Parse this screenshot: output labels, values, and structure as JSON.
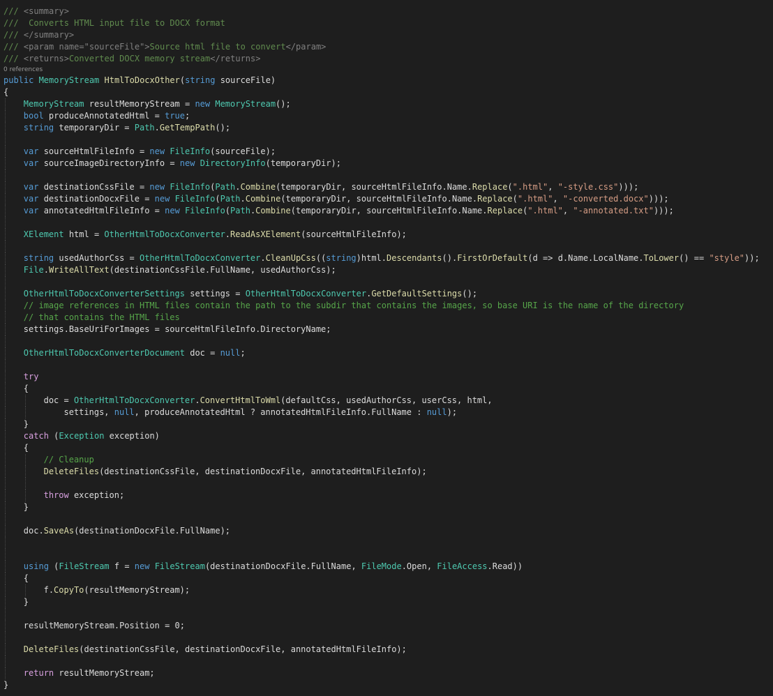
{
  "editor": {
    "colors": {
      "background": "#1e1e1e",
      "text": "#dcdcdc",
      "comment": "#57a64a",
      "doc_comment": "#608b4e",
      "doc_tag": "#808080",
      "keyword": "#569cd6",
      "control_keyword": "#d8a0df",
      "type": "#4ec9b0",
      "method": "#dcdcaa",
      "string": "#d69d85",
      "code_lens": "#999999"
    },
    "lines": [
      {
        "indent": 0,
        "tokens": [
          [
            "doc",
            "/// "
          ],
          [
            "tag",
            "<summary>"
          ]
        ]
      },
      {
        "indent": 0,
        "tokens": [
          [
            "doc",
            "///  Converts HTML input file to DOCX format"
          ]
        ]
      },
      {
        "indent": 0,
        "tokens": [
          [
            "doc",
            "/// "
          ],
          [
            "tag",
            "</summary>"
          ]
        ]
      },
      {
        "indent": 0,
        "tokens": [
          [
            "doc",
            "/// "
          ],
          [
            "tag",
            "<param name=\"sourceFile\">"
          ],
          [
            "doc",
            "Source html file to convert"
          ],
          [
            "tag",
            "</param>"
          ]
        ]
      },
      {
        "indent": 0,
        "tokens": [
          [
            "doc",
            "/// "
          ],
          [
            "tag",
            "<returns>"
          ],
          [
            "doc",
            "Converted DOCX memory stream"
          ],
          [
            "tag",
            "</returns>"
          ]
        ]
      },
      {
        "indent": 0,
        "lens": true,
        "tokens": [
          [
            "lens",
            "0 references"
          ]
        ]
      },
      {
        "indent": 0,
        "tokens": [
          [
            "kw",
            "public "
          ],
          [
            "type",
            "MemoryStream "
          ],
          [
            "meth",
            "HtmlToDocxOther"
          ],
          [
            "plain",
            "("
          ],
          [
            "kw",
            "string "
          ],
          [
            "plain",
            "sourceFile)"
          ]
        ]
      },
      {
        "indent": 0,
        "tokens": [
          [
            "plain",
            "{"
          ]
        ]
      },
      {
        "indent": 1,
        "tokens": [
          [
            "type",
            "MemoryStream "
          ],
          [
            "plain",
            "resultMemoryStream = "
          ],
          [
            "kw",
            "new "
          ],
          [
            "type",
            "MemoryStream"
          ],
          [
            "plain",
            "();"
          ]
        ]
      },
      {
        "indent": 1,
        "tokens": [
          [
            "kw",
            "bool "
          ],
          [
            "plain",
            "produceAnnotatedHtml = "
          ],
          [
            "kw",
            "true"
          ],
          [
            "plain",
            ";"
          ]
        ]
      },
      {
        "indent": 1,
        "tokens": [
          [
            "kw",
            "string "
          ],
          [
            "plain",
            "temporaryDir = "
          ],
          [
            "type",
            "Path"
          ],
          [
            "plain",
            "."
          ],
          [
            "meth",
            "GetTempPath"
          ],
          [
            "plain",
            "();"
          ]
        ]
      },
      {
        "indent": 1,
        "tokens": []
      },
      {
        "indent": 1,
        "tokens": [
          [
            "kw",
            "var "
          ],
          [
            "plain",
            "sourceHtmlFileInfo = "
          ],
          [
            "kw",
            "new "
          ],
          [
            "type",
            "FileInfo"
          ],
          [
            "plain",
            "(sourceFile);"
          ]
        ]
      },
      {
        "indent": 1,
        "tokens": [
          [
            "kw",
            "var "
          ],
          [
            "plain",
            "sourceImageDirectoryInfo = "
          ],
          [
            "kw",
            "new "
          ],
          [
            "type",
            "DirectoryInfo"
          ],
          [
            "plain",
            "(temporaryDir);"
          ]
        ]
      },
      {
        "indent": 1,
        "tokens": []
      },
      {
        "indent": 1,
        "tokens": [
          [
            "kw",
            "var "
          ],
          [
            "plain",
            "destinationCssFile = "
          ],
          [
            "kw",
            "new "
          ],
          [
            "type",
            "FileInfo"
          ],
          [
            "plain",
            "("
          ],
          [
            "type",
            "Path"
          ],
          [
            "plain",
            "."
          ],
          [
            "meth",
            "Combine"
          ],
          [
            "plain",
            "(temporaryDir, sourceHtmlFileInfo.Name."
          ],
          [
            "meth",
            "Replace"
          ],
          [
            "plain",
            "("
          ],
          [
            "str",
            "\".html\""
          ],
          [
            "plain",
            ", "
          ],
          [
            "str",
            "\"-style.css\""
          ],
          [
            "plain",
            ")));"
          ]
        ]
      },
      {
        "indent": 1,
        "tokens": [
          [
            "kw",
            "var "
          ],
          [
            "plain",
            "destinationDocxFile = "
          ],
          [
            "kw",
            "new "
          ],
          [
            "type",
            "FileInfo"
          ],
          [
            "plain",
            "("
          ],
          [
            "type",
            "Path"
          ],
          [
            "plain",
            "."
          ],
          [
            "meth",
            "Combine"
          ],
          [
            "plain",
            "(temporaryDir, sourceHtmlFileInfo.Name."
          ],
          [
            "meth",
            "Replace"
          ],
          [
            "plain",
            "("
          ],
          [
            "str",
            "\".html\""
          ],
          [
            "plain",
            ", "
          ],
          [
            "str",
            "\"-converted.docx\""
          ],
          [
            "plain",
            ")));"
          ]
        ]
      },
      {
        "indent": 1,
        "tokens": [
          [
            "kw",
            "var "
          ],
          [
            "plain",
            "annotatedHtmlFileInfo = "
          ],
          [
            "kw",
            "new "
          ],
          [
            "type",
            "FileInfo"
          ],
          [
            "plain",
            "("
          ],
          [
            "type",
            "Path"
          ],
          [
            "plain",
            "."
          ],
          [
            "meth",
            "Combine"
          ],
          [
            "plain",
            "(temporaryDir, sourceHtmlFileInfo.Name."
          ],
          [
            "meth",
            "Replace"
          ],
          [
            "plain",
            "("
          ],
          [
            "str",
            "\".html\""
          ],
          [
            "plain",
            ", "
          ],
          [
            "str",
            "\"-annotated.txt\""
          ],
          [
            "plain",
            ")));"
          ]
        ]
      },
      {
        "indent": 1,
        "tokens": []
      },
      {
        "indent": 1,
        "tokens": [
          [
            "type",
            "XElement "
          ],
          [
            "plain",
            "html = "
          ],
          [
            "type",
            "OtherHtmlToDocxConverter"
          ],
          [
            "plain",
            "."
          ],
          [
            "meth",
            "ReadAsXElement"
          ],
          [
            "plain",
            "(sourceHtmlFileInfo);"
          ]
        ]
      },
      {
        "indent": 1,
        "tokens": []
      },
      {
        "indent": 1,
        "tokens": [
          [
            "kw",
            "string "
          ],
          [
            "plain",
            "usedAuthorCss = "
          ],
          [
            "type",
            "OtherHtmlToDocxConverter"
          ],
          [
            "plain",
            "."
          ],
          [
            "meth",
            "CleanUpCss"
          ],
          [
            "plain",
            "(("
          ],
          [
            "kw",
            "string"
          ],
          [
            "plain",
            ")html."
          ],
          [
            "meth",
            "Descendants"
          ],
          [
            "plain",
            "()."
          ],
          [
            "meth",
            "FirstOrDefault"
          ],
          [
            "plain",
            "(d => d.Name.LocalName."
          ],
          [
            "meth",
            "ToLower"
          ],
          [
            "plain",
            "() == "
          ],
          [
            "str",
            "\"style\""
          ],
          [
            "plain",
            "));"
          ]
        ]
      },
      {
        "indent": 1,
        "tokens": [
          [
            "type",
            "File"
          ],
          [
            "plain",
            "."
          ],
          [
            "meth",
            "WriteAllText"
          ],
          [
            "plain",
            "(destinationCssFile.FullName, usedAuthorCss);"
          ]
        ]
      },
      {
        "indent": 1,
        "tokens": []
      },
      {
        "indent": 1,
        "tokens": [
          [
            "type",
            "OtherHtmlToDocxConverterSettings "
          ],
          [
            "plain",
            "settings = "
          ],
          [
            "type",
            "OtherHtmlToDocxConverter"
          ],
          [
            "plain",
            "."
          ],
          [
            "meth",
            "GetDefaultSettings"
          ],
          [
            "plain",
            "();"
          ]
        ]
      },
      {
        "indent": 1,
        "tokens": [
          [
            "com",
            "// image references in HTML files contain the path to the subdir that contains the images, so base URI is the name of the directory"
          ]
        ]
      },
      {
        "indent": 1,
        "tokens": [
          [
            "com",
            "// that contains the HTML files"
          ]
        ]
      },
      {
        "indent": 1,
        "tokens": [
          [
            "plain",
            "settings.BaseUriForImages = sourceHtmlFileInfo.DirectoryName;"
          ]
        ]
      },
      {
        "indent": 1,
        "tokens": []
      },
      {
        "indent": 1,
        "tokens": [
          [
            "type",
            "OtherHtmlToDocxConverterDocument "
          ],
          [
            "plain",
            "doc = "
          ],
          [
            "kw",
            "null"
          ],
          [
            "plain",
            ";"
          ]
        ]
      },
      {
        "indent": 1,
        "tokens": []
      },
      {
        "indent": 1,
        "tokens": [
          [
            "ctl",
            "try"
          ]
        ]
      },
      {
        "indent": 1,
        "tokens": [
          [
            "plain",
            "{"
          ]
        ]
      },
      {
        "indent": 2,
        "tokens": [
          [
            "plain",
            "doc = "
          ],
          [
            "type",
            "OtherHtmlToDocxConverter"
          ],
          [
            "plain",
            "."
          ],
          [
            "meth",
            "ConvertHtmlToWml"
          ],
          [
            "plain",
            "(defaultCss, usedAuthorCss, userCss, html,"
          ]
        ]
      },
      {
        "indent": 2,
        "tokens": [
          [
            "plain",
            "    settings, "
          ],
          [
            "kw",
            "null"
          ],
          [
            "plain",
            ", produceAnnotatedHtml ? annotatedHtmlFileInfo.FullName : "
          ],
          [
            "kw",
            "null"
          ],
          [
            "plain",
            ");"
          ]
        ]
      },
      {
        "indent": 1,
        "tokens": [
          [
            "plain",
            "}"
          ]
        ]
      },
      {
        "indent": 1,
        "tokens": [
          [
            "ctl",
            "catch "
          ],
          [
            "plain",
            "("
          ],
          [
            "type",
            "Exception "
          ],
          [
            "plain",
            "exception)"
          ]
        ]
      },
      {
        "indent": 1,
        "tokens": [
          [
            "plain",
            "{"
          ]
        ]
      },
      {
        "indent": 2,
        "tokens": [
          [
            "com",
            "// Cleanup"
          ]
        ]
      },
      {
        "indent": 2,
        "tokens": [
          [
            "meth",
            "DeleteFiles"
          ],
          [
            "plain",
            "(destinationCssFile, destinationDocxFile, annotatedHtmlFileInfo);"
          ]
        ]
      },
      {
        "indent": 2,
        "tokens": []
      },
      {
        "indent": 2,
        "tokens": [
          [
            "ctl",
            "throw "
          ],
          [
            "plain",
            "exception;"
          ]
        ]
      },
      {
        "indent": 1,
        "tokens": [
          [
            "plain",
            "}"
          ]
        ]
      },
      {
        "indent": 1,
        "tokens": []
      },
      {
        "indent": 1,
        "tokens": [
          [
            "plain",
            "doc."
          ],
          [
            "meth",
            "SaveAs"
          ],
          [
            "plain",
            "(destinationDocxFile.FullName);"
          ]
        ]
      },
      {
        "indent": 1,
        "tokens": []
      },
      {
        "indent": 1,
        "tokens": []
      },
      {
        "indent": 1,
        "tokens": [
          [
            "kw",
            "using "
          ],
          [
            "plain",
            "("
          ],
          [
            "type",
            "FileStream "
          ],
          [
            "plain",
            "f = "
          ],
          [
            "kw",
            "new "
          ],
          [
            "type",
            "FileStream"
          ],
          [
            "plain",
            "(destinationDocxFile.FullName, "
          ],
          [
            "type",
            "FileMode"
          ],
          [
            "plain",
            ".Open, "
          ],
          [
            "type",
            "FileAccess"
          ],
          [
            "plain",
            ".Read))"
          ]
        ]
      },
      {
        "indent": 1,
        "tokens": [
          [
            "plain",
            "{"
          ]
        ]
      },
      {
        "indent": 2,
        "tokens": [
          [
            "plain",
            "f."
          ],
          [
            "meth",
            "CopyTo"
          ],
          [
            "plain",
            "(resultMemoryStream);"
          ]
        ]
      },
      {
        "indent": 1,
        "tokens": [
          [
            "plain",
            "}"
          ]
        ]
      },
      {
        "indent": 1,
        "tokens": []
      },
      {
        "indent": 1,
        "tokens": [
          [
            "plain",
            "resultMemoryStream.Position = 0;"
          ]
        ]
      },
      {
        "indent": 1,
        "tokens": []
      },
      {
        "indent": 1,
        "tokens": [
          [
            "meth",
            "DeleteFiles"
          ],
          [
            "plain",
            "(destinationCssFile, destinationDocxFile, annotatedHtmlFileInfo);"
          ]
        ]
      },
      {
        "indent": 1,
        "tokens": []
      },
      {
        "indent": 1,
        "tokens": [
          [
            "ctl",
            "return "
          ],
          [
            "plain",
            "resultMemoryStream;"
          ]
        ]
      },
      {
        "indent": 0,
        "tokens": [
          [
            "plain",
            "}"
          ]
        ]
      }
    ]
  }
}
